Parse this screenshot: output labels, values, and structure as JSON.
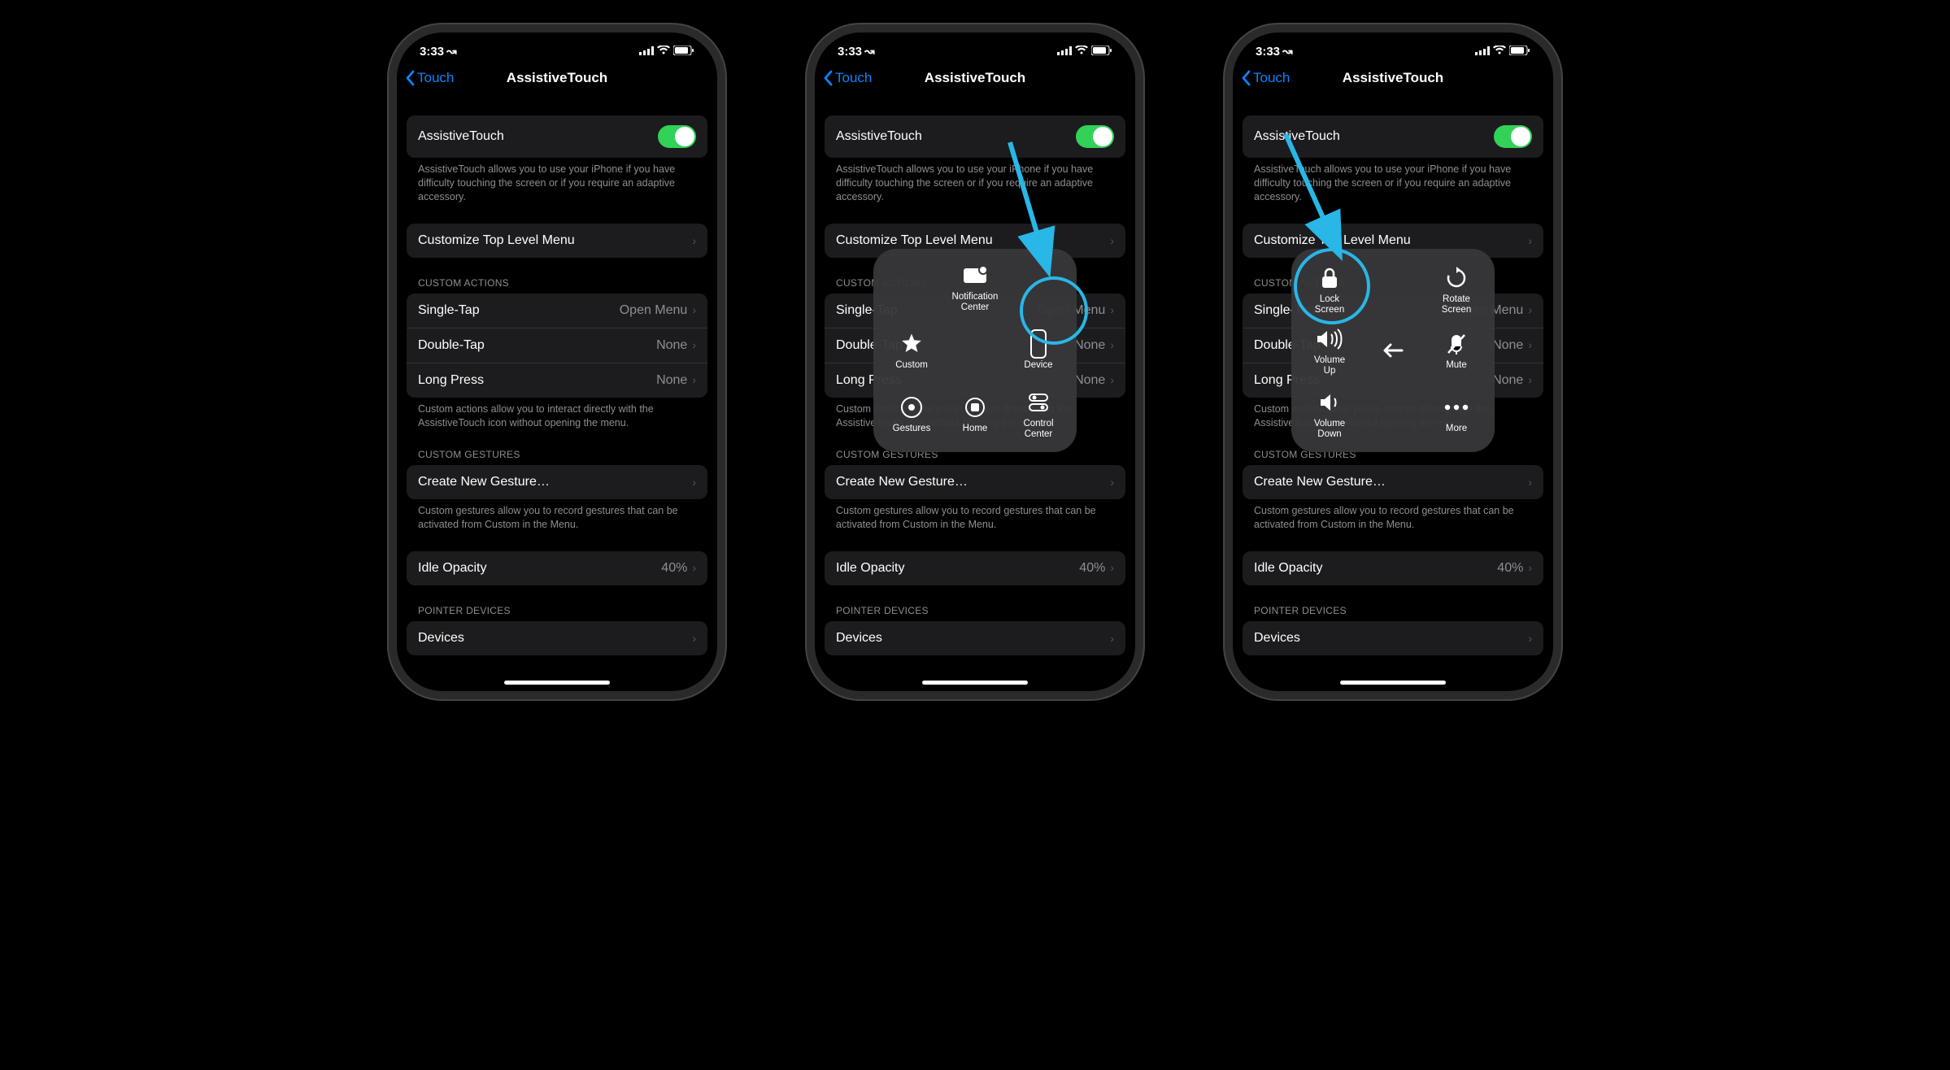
{
  "status": {
    "time": "3:33",
    "location_arrow": "↗"
  },
  "nav": {
    "back": "Touch",
    "title": "AssistiveTouch"
  },
  "toggle_row": {
    "label": "AssistiveTouch"
  },
  "toggle_note": "AssistiveTouch allows you to use your iPhone if you have difficulty touching the screen or if you require an adaptive accessory.",
  "customize": "Customize Top Level Menu",
  "custom_actions_header": "CUSTOM ACTIONS",
  "actions": [
    {
      "label": "Single-Tap",
      "value": "Open Menu"
    },
    {
      "label": "Double-Tap",
      "value": "None"
    },
    {
      "label": "Long Press",
      "value": "None"
    }
  ],
  "actions_note": "Custom actions allow you to interact directly with the AssistiveTouch icon without opening the menu.",
  "gestures_header": "CUSTOM GESTURES",
  "create_gesture": "Create New Gesture…",
  "gestures_note": "Custom gestures allow you to record gestures that can be activated from Custom in the Menu.",
  "idle_opacity": {
    "label": "Idle Opacity",
    "value": "40%"
  },
  "pointer_header": "POINTER DEVICES",
  "devices": "Devices",
  "overlay1": {
    "custom": "Custom",
    "notification_center": "Notification\nCenter",
    "device": "Device",
    "gestures": "Gestures",
    "home": "Home",
    "control_center": "Control\nCenter"
  },
  "overlay2": {
    "lock_screen": "Lock\nScreen",
    "rotate_screen": "Rotate\nScreen",
    "volume_up": "Volume\nUp",
    "mute": "Mute",
    "volume_down": "Volume\nDown",
    "more": "More"
  }
}
